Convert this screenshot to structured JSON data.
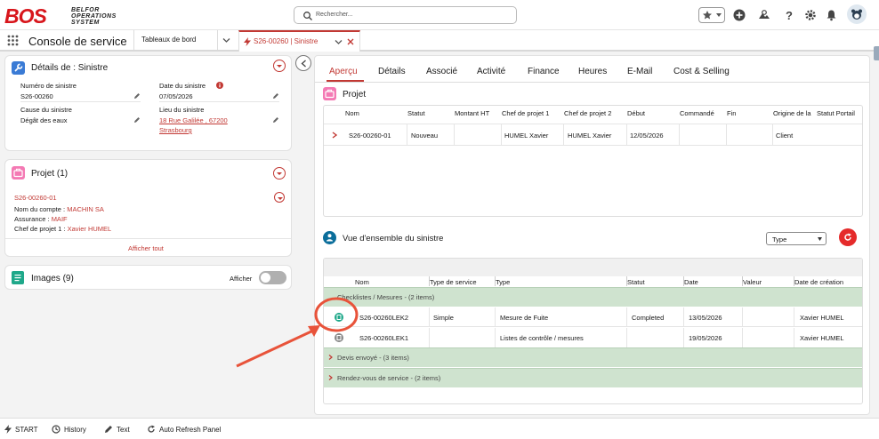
{
  "header": {
    "logo_text": "BOS",
    "logo_sub1": "BELFOR",
    "logo_sub2": "OPERATIONS",
    "logo_sub3": "SYSTEM",
    "search_placeholder": "Rechercher..."
  },
  "nav": {
    "app_name": "Console de service",
    "tab_dashboard": "Tableaux de bord",
    "tab_record": "S26-00260 | Sinistre"
  },
  "details_card": {
    "title": "Détails de : Sinistre",
    "numero_label": "Numéro de sinistre",
    "numero_value": "S26-00260",
    "date_label": "Date du sinistre",
    "date_value": "07/05/2026",
    "cause_label": "Cause du sinistre",
    "cause_value": "Dégât des eaux",
    "lieu_label": "Lieu du sinistre",
    "lieu_line1": "18 Rue Galilée , 67200",
    "lieu_line2": "Strasbourg"
  },
  "projet_card": {
    "title": "Projet (1)",
    "item_name": "S26-00260-01",
    "compte_label": "Nom du compte : ",
    "compte_value": "MACHIN SA",
    "assurance_label": "Assurance : ",
    "assurance_value": "MAIF",
    "chef_label": "Chef de projet 1 : ",
    "chef_value": "Xavier HUMEL",
    "show_all": "Afficher tout"
  },
  "images_card": {
    "title": "Images (9)",
    "toggle_label": "Afficher"
  },
  "main_tabs": [
    "Aperçu",
    "Détails",
    "Associé",
    "Activité",
    "Finance",
    "Heures",
    "E-Mail",
    "Cost & Selling"
  ],
  "projet_section": {
    "title": "Projet",
    "columns": [
      "Nom",
      "Statut",
      "Montant HT",
      "Chef de projet 1",
      "Chef de projet 2",
      "Début",
      "Commandé",
      "Fin",
      "Origine de la",
      "Statut Portail"
    ],
    "row": {
      "nom": "S26-00260-01",
      "statut": "Nouveau",
      "chef1": "HUMEL Xavier",
      "chef2": "HUMEL Xavier",
      "debut": "12/05/2026",
      "origine": "Client"
    }
  },
  "vue_section": {
    "title": "Vue d'ensemble du sinistre",
    "type_select": "Type",
    "columns": [
      "Nom",
      "Type de service",
      "Type",
      "Statut",
      "Date",
      "Valeur",
      "Date de création"
    ],
    "group1": "Checklistes / Mesures - (2 items)",
    "rows": [
      {
        "nom": "S26-00260LEK2",
        "type_service": "Simple",
        "type": "Mesure de Fuite",
        "statut": "Completed",
        "date": "13/05/2026",
        "valeur": "",
        "creation": "Xavier HUMEL"
      },
      {
        "nom": "S26-00260LEK1",
        "type_service": "",
        "type": "Listes de contrôle / mesures",
        "statut": "",
        "date": "19/05/2026",
        "valeur": "",
        "creation": "Xavier HUMEL"
      }
    ],
    "group2": "Devis envoyé - (3 items)",
    "group3": "Rendez-vous de service - (2 items)"
  },
  "bottom_bar": {
    "start": "START",
    "history": "History",
    "text": "Text",
    "auto_refresh": "Auto Refresh Panel"
  },
  "colors": {
    "accent": "#c23934",
    "group_bg": "#cfe3cf",
    "annotation": "#e8533a",
    "projet_icon": "#f47ab4",
    "images_icon": "#1fa88a",
    "vue_icon": "#0b6e9b"
  }
}
